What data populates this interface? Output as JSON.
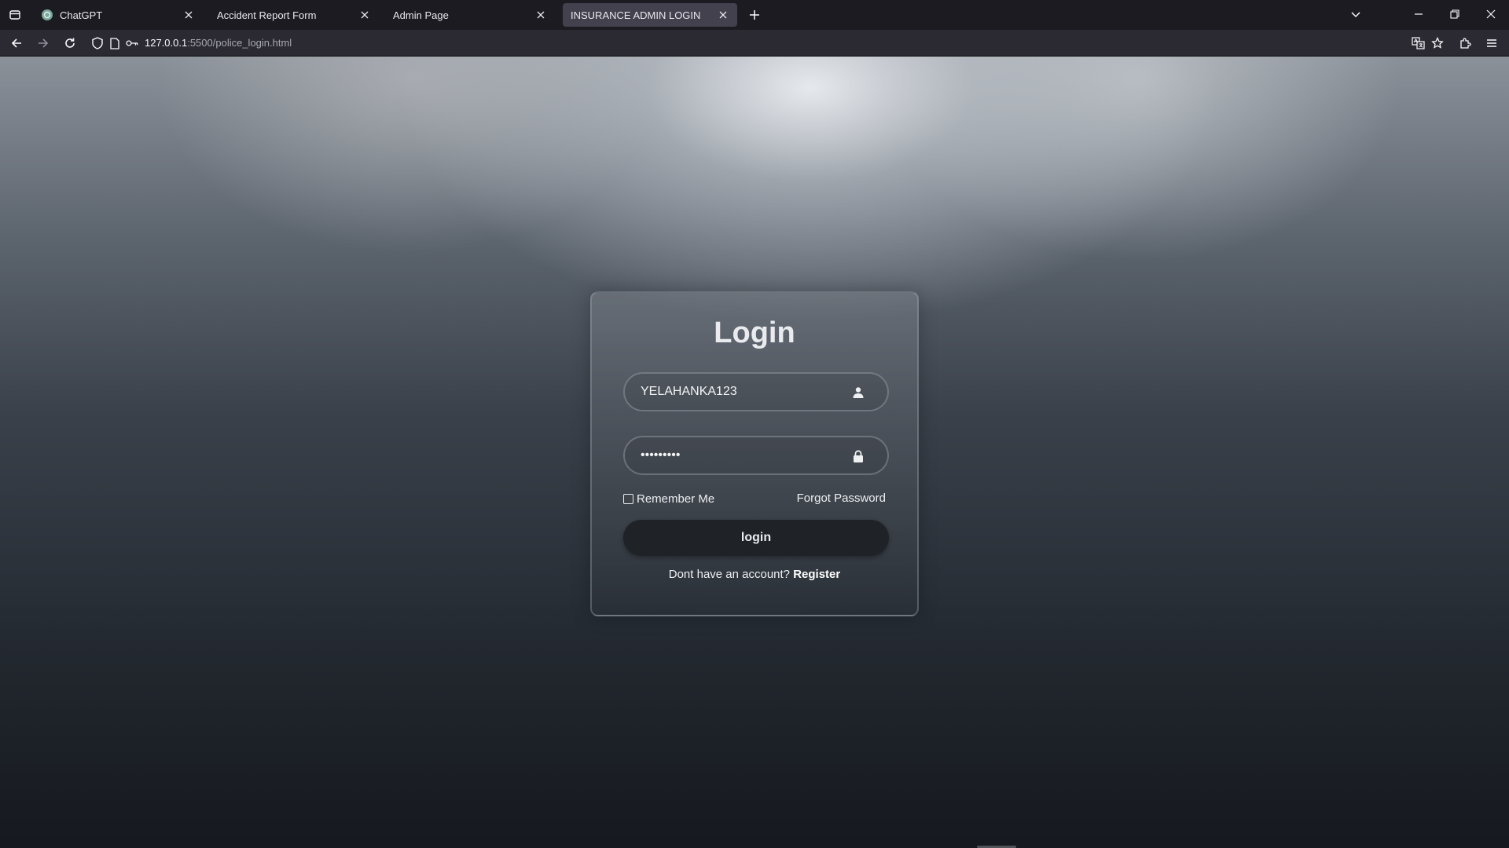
{
  "browser": {
    "tabs": [
      {
        "title": "ChatGPT",
        "favicon": "chatgpt-icon",
        "active": false
      },
      {
        "title": "Accident Report Form",
        "favicon": "",
        "active": false
      },
      {
        "title": "Admin Page",
        "favicon": "",
        "active": false
      },
      {
        "title": "INSURANCE ADMIN LOGIN",
        "favicon": "",
        "active": true
      }
    ],
    "url": {
      "host": "127.0.0.1",
      "path": ":5500/police_login.html"
    }
  },
  "login": {
    "heading": "Login",
    "username_value": "YELAHANKA123",
    "password_value": "•••••••••",
    "remember_label": "Remember Me",
    "remember_checked": false,
    "forgot_label": "Forgot Password",
    "submit_label": "login",
    "register_prompt": "Dont have an account?",
    "register_link": "Register"
  },
  "colors": {
    "button": "#1f2328",
    "tab_active": "#42414d",
    "tabbar": "#1c1b22",
    "navbar": "#2b2a33"
  }
}
